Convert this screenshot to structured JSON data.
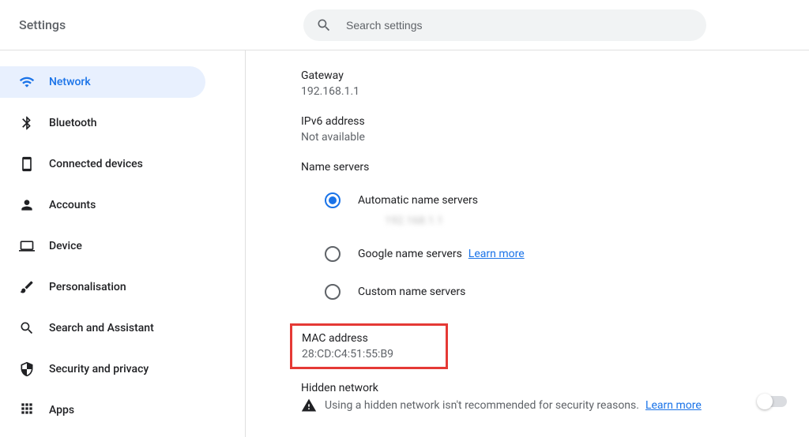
{
  "header": {
    "title": "Settings",
    "search_placeholder": "Search settings"
  },
  "sidebar": {
    "items": [
      {
        "label": "Network",
        "icon": "wifi-icon",
        "active": true
      },
      {
        "label": "Bluetooth",
        "icon": "bluetooth-icon"
      },
      {
        "label": "Connected devices",
        "icon": "phone-icon"
      },
      {
        "label": "Accounts",
        "icon": "person-icon"
      },
      {
        "label": "Device",
        "icon": "laptop-icon"
      },
      {
        "label": "Personalisation",
        "icon": "brush-icon"
      },
      {
        "label": "Search and Assistant",
        "icon": "search-icon"
      },
      {
        "label": "Security and privacy",
        "icon": "shield-icon"
      },
      {
        "label": "Apps",
        "icon": "apps-icon"
      }
    ]
  },
  "content": {
    "gateway": {
      "label": "Gateway",
      "value": "192.168.1.1"
    },
    "ipv6": {
      "label": "IPv6 address",
      "value": "Not available"
    },
    "name_servers": {
      "label": "Name servers",
      "options": [
        {
          "label": "Automatic name servers",
          "checked": true,
          "sub_value": "192.168.1.1"
        },
        {
          "label": "Google name servers",
          "checked": false,
          "learn_more": "Learn more"
        },
        {
          "label": "Custom name servers",
          "checked": false
        }
      ]
    },
    "mac": {
      "label": "MAC address",
      "value": "28:CD:C4:51:55:B9"
    },
    "hidden": {
      "label": "Hidden network",
      "warning": "Using a hidden network isn't recommended for security reasons.",
      "learn_more": "Learn more",
      "toggle": false
    }
  }
}
